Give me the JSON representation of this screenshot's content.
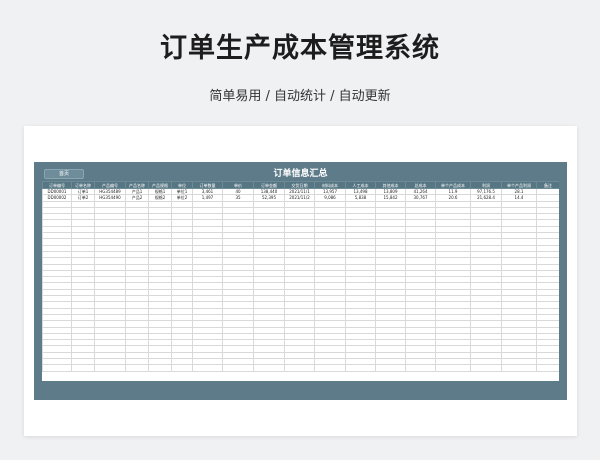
{
  "hero": {
    "title": "订单生产成本管理系统",
    "subtitle": "简单易用 / 自动统计 / 自动更新"
  },
  "sheet": {
    "title": "订单信息汇总",
    "home_label": "首页",
    "columns": [
      "订单编号",
      "订单名称",
      "产品编号",
      "产品名称",
      "产品规格",
      "单位",
      "订单数量",
      "单价",
      "订单金额",
      "交货日期",
      "材料成本",
      "人工成本",
      "其他成本",
      "总成本",
      "单个产品成本",
      "利润",
      "单个产品利润",
      "备注"
    ],
    "rows": [
      [
        "DD00001",
        "订单1",
        "HG354489",
        "产品1",
        "规格1",
        "单位1",
        "3,461",
        "40",
        "138,440",
        "2021/11/1",
        "13,957",
        "13,498",
        "13,809",
        "41,264",
        "11.9",
        "97,176.5",
        "28.1",
        ""
      ],
      [
        "DD00002",
        "订单2",
        "HG354490",
        "产品2",
        "规格2",
        "单位2",
        "1,497",
        "35",
        "52,395",
        "2021/11/2",
        "9,086",
        "5,838",
        "15,842",
        "30,767",
        "20.6",
        "21,628.4",
        "14.4",
        ""
      ]
    ],
    "blank_rows": 27
  },
  "colors": {
    "frame": "#5d7b89",
    "header": "#567683",
    "background": "#f0f1f3"
  }
}
